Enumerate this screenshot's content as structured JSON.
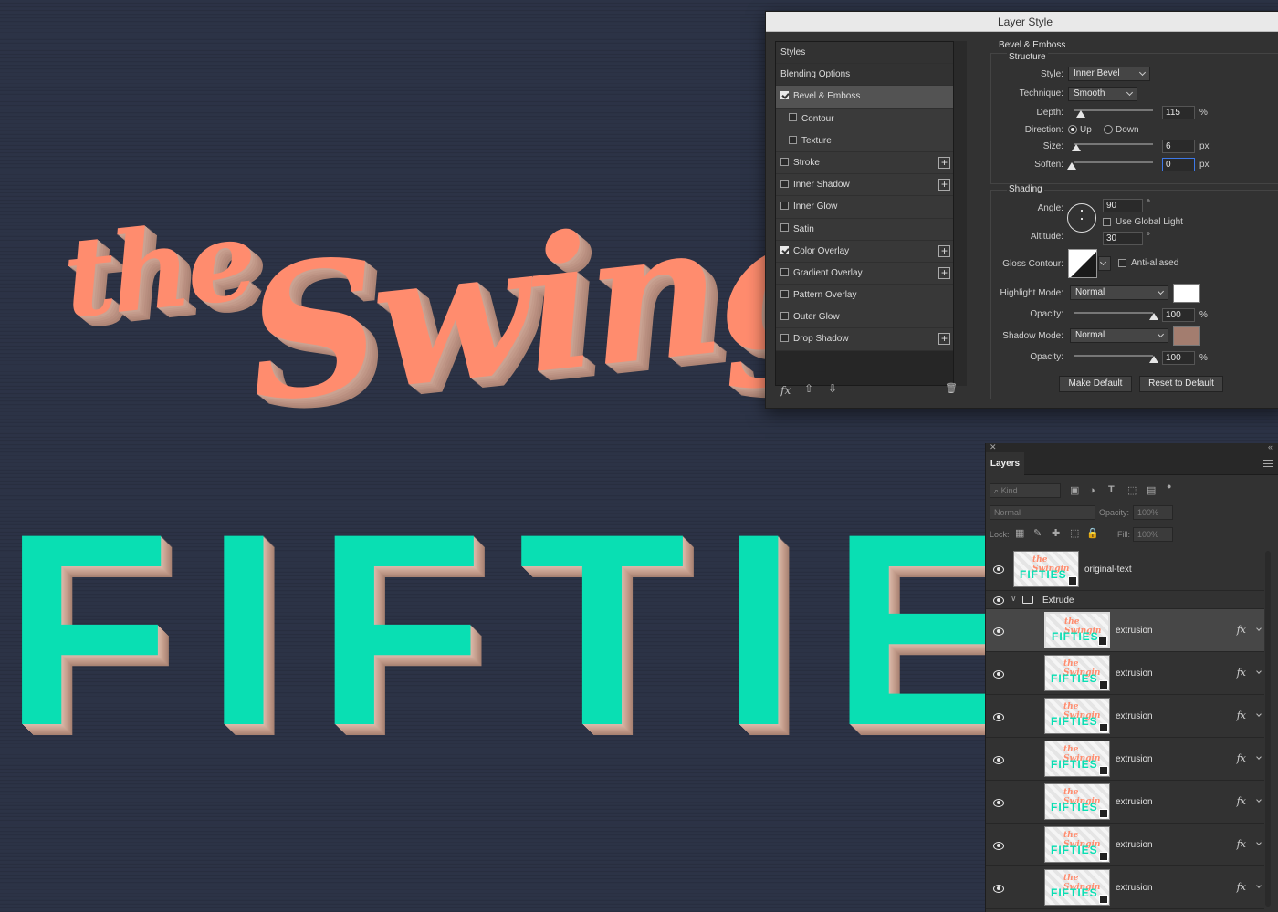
{
  "canvas": {
    "the_text": "the",
    "swinging_text": "Swingi",
    "fifties_text": "FIFTIES",
    "colors": {
      "coral": "#ff8c6e",
      "teal": "#09dfb3",
      "extrude": "#c49c8c",
      "background": "#2c3346"
    }
  },
  "dialog": {
    "title": "Layer Style",
    "styles": [
      {
        "label": "Styles",
        "checkbox": false
      },
      {
        "label": "Blending Options",
        "checkbox": false
      },
      {
        "label": "Bevel & Emboss",
        "checked": true,
        "selected": true
      },
      {
        "label": "Contour",
        "checked": false,
        "sub": true
      },
      {
        "label": "Texture",
        "checked": false,
        "sub": true
      },
      {
        "label": "Stroke",
        "checked": false,
        "plus": true
      },
      {
        "label": "Inner Shadow",
        "checked": false,
        "plus": true
      },
      {
        "label": "Inner Glow",
        "checked": false
      },
      {
        "label": "Satin",
        "checked": false
      },
      {
        "label": "Color Overlay",
        "checked": true,
        "plus": true
      },
      {
        "label": "Gradient Overlay",
        "checked": false,
        "plus": true
      },
      {
        "label": "Pattern Overlay",
        "checked": false
      },
      {
        "label": "Outer Glow",
        "checked": false
      },
      {
        "label": "Drop Shadow",
        "checked": false,
        "plus": true
      }
    ],
    "footer": {
      "fx_label": "fx",
      "up_icon": "arrow-up-icon",
      "down_icon": "arrow-down-icon",
      "trash_icon": "trash-icon"
    },
    "bevel": {
      "heading": "Bevel & Emboss",
      "structure": "Structure",
      "style_label": "Style:",
      "style_value": "Inner Bevel",
      "technique_label": "Technique:",
      "technique_value": "Smooth",
      "depth_label": "Depth:",
      "depth_value": "115",
      "depth_unit": "%",
      "direction_label": "Direction:",
      "dir_up": "Up",
      "dir_down": "Down",
      "direction_selected": "Up",
      "size_label": "Size:",
      "size_value": "6",
      "size_unit": "px",
      "soften_label": "Soften:",
      "soften_value": "0",
      "soften_unit": "px"
    },
    "shading": {
      "heading": "Shading",
      "angle_label": "Angle:",
      "angle_value": "90",
      "angle_unit": "°",
      "global_light": "Use Global Light",
      "global_light_checked": false,
      "altitude_label": "Altitude:",
      "altitude_value": "30",
      "altitude_unit": "°",
      "gloss_label": "Gloss Contour:",
      "anti_aliased": "Anti-aliased",
      "anti_aliased_checked": false,
      "highlight_label": "Highlight Mode:",
      "highlight_mode": "Normal",
      "highlight_color": "#ffffff",
      "opacity1_label": "Opacity:",
      "opacity1_value": "100",
      "opacity1_unit": "%",
      "shadow_label": "Shadow Mode:",
      "shadow_mode": "Normal",
      "shadow_color": "#a37d6f",
      "opacity2_label": "Opacity:",
      "opacity2_value": "100",
      "opacity2_unit": "%"
    },
    "buttons": {
      "make_default": "Make Default",
      "reset_default": "Reset to Default"
    }
  },
  "layers_panel": {
    "tab": "Layers",
    "kind_placeholder": "Kind",
    "blend_mode": "Normal",
    "opacity_label": "Opacity:",
    "opacity_value": "100%",
    "lock_label": "Lock:",
    "fill_label": "Fill:",
    "fill_value": "100%",
    "thumb_the": "the Swingin",
    "thumb_fifties": "FIFTIES",
    "layers": [
      {
        "name": "original-text",
        "type": "layer",
        "fx": false
      },
      {
        "name": "Extrude",
        "type": "group"
      },
      {
        "name": "extrusion",
        "type": "layer",
        "fx": true,
        "selected": true
      },
      {
        "name": "extrusion",
        "type": "layer",
        "fx": true
      },
      {
        "name": "extrusion",
        "type": "layer",
        "fx": true
      },
      {
        "name": "extrusion",
        "type": "layer",
        "fx": true
      },
      {
        "name": "extrusion",
        "type": "layer",
        "fx": true
      },
      {
        "name": "extrusion",
        "type": "layer",
        "fx": true
      },
      {
        "name": "extrusion",
        "type": "layer",
        "fx": true
      }
    ],
    "fx_label": "fx"
  }
}
